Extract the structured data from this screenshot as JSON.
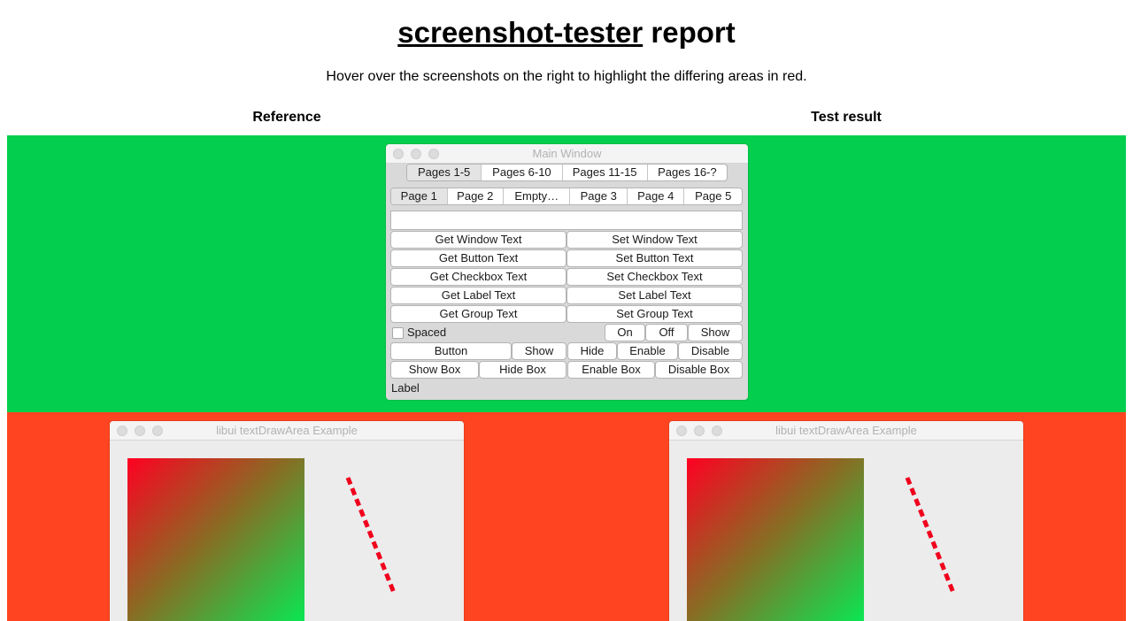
{
  "header": {
    "title_link": "screenshot-tester",
    "title_rest": " report",
    "subtitle": "Hover over the screenshots on the right to highlight the differing areas in red."
  },
  "columns": {
    "reference": "Reference",
    "test": "Test result"
  },
  "colors": {
    "match_band": "#03ce4d",
    "diff_band": "#fe4421"
  },
  "main_window": {
    "title": "Main Window",
    "outer_tabs": [
      "Pages 1-5",
      "Pages 6-10",
      "Pages 11-15",
      "Pages 16-?"
    ],
    "inner_tabs": [
      "Page 1",
      "Page 2",
      "Empty…",
      "Page 3",
      "Page 4",
      "Page 5"
    ],
    "text_field_value": "",
    "button_pairs": [
      [
        "Get Window Text",
        "Set Window Text"
      ],
      [
        "Get Button Text",
        "Set Button Text"
      ],
      [
        "Get Checkbox Text",
        "Set Checkbox Text"
      ],
      [
        "Get Label Text",
        "Set Label Text"
      ],
      [
        "Get Group Text",
        "Set Group Text"
      ]
    ],
    "checkbox_label": "Spaced",
    "checkbox_checked": false,
    "row_on_off": [
      "On",
      "Off",
      "Show"
    ],
    "row_buttons": [
      "Button",
      "Show",
      "Hide",
      "Enable",
      "Disable"
    ],
    "row_boxes": [
      "Show Box",
      "Hide Box",
      "Enable Box",
      "Disable Box"
    ],
    "label": "Label"
  },
  "draw_window": {
    "title": "libui textDrawArea Example"
  }
}
